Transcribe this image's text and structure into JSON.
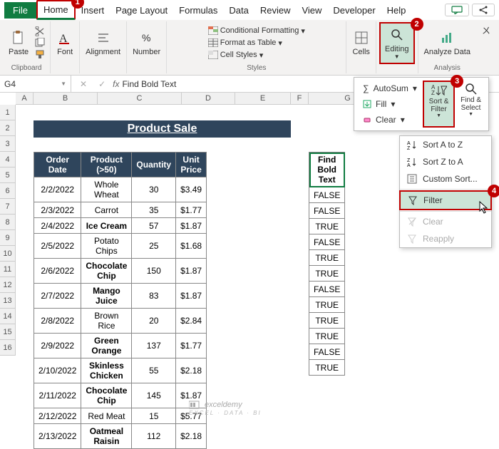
{
  "menubar": {
    "file": "File",
    "home": "Home",
    "insert": "Insert",
    "pageLayout": "Page Layout",
    "formulas": "Formulas",
    "data": "Data",
    "review": "Review",
    "view": "View",
    "developer": "Developer",
    "help": "Help"
  },
  "ribbon": {
    "clipboard": {
      "paste": "Paste",
      "label": "Clipboard"
    },
    "font": {
      "btn": "Font"
    },
    "alignment": {
      "btn": "Alignment"
    },
    "number": {
      "btn": "Number"
    },
    "styles": {
      "condFmt": "Conditional Formatting",
      "formatTable": "Format as Table",
      "cellStyles": "Cell Styles",
      "label": "Styles"
    },
    "cells": {
      "btn": "Cells"
    },
    "editing": {
      "btn": "Editing"
    },
    "analysis": {
      "btn": "Analyze Data",
      "label": "Analysis"
    }
  },
  "namebox": {
    "value": "G4",
    "formula": "Find Bold Text"
  },
  "editDropdown": {
    "autosum": "AutoSum",
    "fill": "Fill",
    "clear": "Clear",
    "sortFilter": "Sort & Filter",
    "findSelect": "Find & Select"
  },
  "sortMenu": {
    "sortAZ": "Sort A to Z",
    "sortZA": "Sort Z to A",
    "custom": "Custom Sort...",
    "filter": "Filter",
    "clear": "Clear",
    "reapply": "Reapply"
  },
  "colWidths": {
    "A": 25,
    "B": 90,
    "C": 118,
    "D": 75,
    "E": 78,
    "F": 25,
    "G": 110
  },
  "title": "Product Sale",
  "table": {
    "headers": {
      "date": "Order Date",
      "product": "Product (>50)",
      "qty": "Quantity",
      "price": "Unit Price"
    },
    "rows": [
      {
        "date": "2/2/2022",
        "product": "Whole Wheat",
        "bold": false,
        "qty": 30,
        "price": "$3.49"
      },
      {
        "date": "2/3/2022",
        "product": "Carrot",
        "bold": false,
        "qty": 35,
        "price": "$1.77"
      },
      {
        "date": "2/4/2022",
        "product": "Ice Cream",
        "bold": true,
        "qty": 57,
        "price": "$1.87"
      },
      {
        "date": "2/5/2022",
        "product": "Potato Chips",
        "bold": false,
        "qty": 25,
        "price": "$1.68"
      },
      {
        "date": "2/6/2022",
        "product": "Chocolate Chip",
        "bold": true,
        "qty": 150,
        "price": "$1.87"
      },
      {
        "date": "2/7/2022",
        "product": "Mango Juice",
        "bold": true,
        "qty": 83,
        "price": "$1.87"
      },
      {
        "date": "2/8/2022",
        "product": "Brown Rice",
        "bold": false,
        "qty": 20,
        "price": "$2.84"
      },
      {
        "date": "2/9/2022",
        "product": "Green Orange",
        "bold": true,
        "qty": 137,
        "price": "$1.77"
      },
      {
        "date": "2/10/2022",
        "product": "Skinless Chicken",
        "bold": true,
        "qty": 55,
        "price": "$2.18"
      },
      {
        "date": "2/11/2022",
        "product": "Chocolate Chip",
        "bold": true,
        "qty": 145,
        "price": "$1.87"
      },
      {
        "date": "2/12/2022",
        "product": "Red Meat",
        "bold": false,
        "qty": 15,
        "price": "$5.77"
      },
      {
        "date": "2/13/2022",
        "product": "Oatmeal Raisin",
        "bold": true,
        "qty": 112,
        "price": "$2.18"
      }
    ]
  },
  "findBold": {
    "header": "Find Bold Text",
    "values": [
      "FALSE",
      "FALSE",
      "TRUE",
      "FALSE",
      "TRUE",
      "TRUE",
      "FALSE",
      "TRUE",
      "TRUE",
      "TRUE",
      "FALSE",
      "TRUE"
    ]
  },
  "badges": {
    "one": "1",
    "two": "2",
    "three": "3",
    "four": "4"
  },
  "watermark": "exceldemy"
}
